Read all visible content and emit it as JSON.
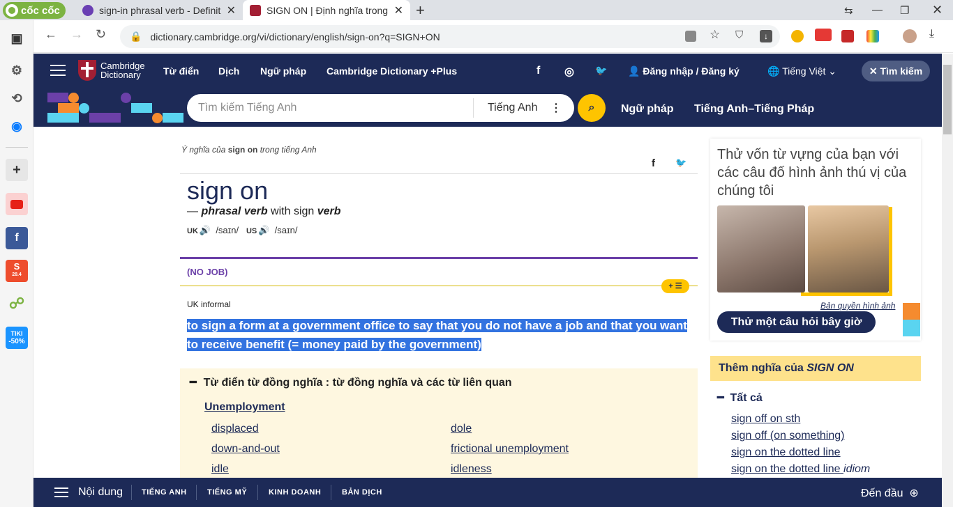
{
  "browser": {
    "logo_text": "cốc cốc",
    "tabs": [
      {
        "title": "sign-in phrasal verb - Definiti",
        "close": "✕"
      },
      {
        "title": "SIGN ON | Định nghĩa trong T",
        "close": "✕"
      }
    ],
    "new_tab": "+",
    "url": "dictionary.cambridge.org/vi/dictionary/english/sign-on?q=SIGN+ON",
    "colors": {
      "chrome": "#dee1e6",
      "accent_green": "#7cb342"
    }
  },
  "sidebar": {
    "items": [
      "settings-icon",
      "history-icon",
      "messenger-icon",
      "add-icon",
      "youtube-icon",
      "facebook-icon",
      "shopee-icon",
      "coccoc-icon",
      "tiki-icon"
    ],
    "tiki_label": "TIKI",
    "tiki_badge": "-50%",
    "shopee_label": "S",
    "shopee_badge": "28.4"
  },
  "header": {
    "logo_line1": "Cambridge",
    "logo_line2": "Dictionary",
    "links": [
      "Từ điển",
      "Dịch",
      "Ngữ pháp",
      "Cambridge Dictionary +Plus"
    ],
    "social": [
      "f",
      "◎",
      "🐦"
    ],
    "login": "Đăng nhập / Đăng ký",
    "language": "Tiếng Việt",
    "search_toggle": "✕ Tìm kiếm",
    "brand_color": "#1d2a57"
  },
  "search": {
    "placeholder": "Tìm kiếm Tiếng Anh",
    "lang": "Tiếng Anh",
    "links": [
      "Ngữ pháp",
      "Tiếng Anh–Tiếng Pháp"
    ]
  },
  "entry": {
    "crumb_prefix": "Ý nghĩa của ",
    "crumb_word": "sign on",
    "crumb_suffix": " trong tiếng Anh",
    "headword": "sign on",
    "pos_dash": "— ",
    "pos": "phrasal verb",
    "pos_with": " with sign ",
    "pos_verb": "verb",
    "uk_label": "UK",
    "uk_ipa": "/saɪn/",
    "us_label": "US",
    "us_ipa": "/saɪn/",
    "guideword": "(NO JOB)",
    "add_list": "+ ☰",
    "register": "UK informal",
    "definition": "to sign a form at a government office to say that you do not have a job and that you want to receive benefit (= money paid by the government)"
  },
  "thesaurus": {
    "title": "Từ điển từ đồng nghĩa : từ đồng nghĩa và các từ liên quan",
    "category": "Unemployment",
    "words": [
      "displaced",
      "dole",
      "down-and-out",
      "frictional unemployment",
      "idle",
      "idleness"
    ]
  },
  "ad": {
    "question": "Thử vốn từ vựng của bạn với các câu đố hình ảnh thú vị của chúng tôi",
    "copyright": "Bản quyền hình ảnh",
    "button": "Thử một câu hỏi bây giờ"
  },
  "more": {
    "prefix": "Thêm nghĩa của ",
    "word": "SIGN ON",
    "all": "Tất cả",
    "links": [
      "sign off on sth",
      "sign off (on something)",
      "sign on the dotted line",
      "sign on the dotted line"
    ],
    "idiom": "idiom"
  },
  "footer": {
    "menu_label": "Nội dung",
    "links": [
      "TIẾNG ANH",
      "TIẾNG MỸ",
      "KINH DOANH",
      "BẢN DỊCH"
    ],
    "top": "Đến đầu"
  }
}
